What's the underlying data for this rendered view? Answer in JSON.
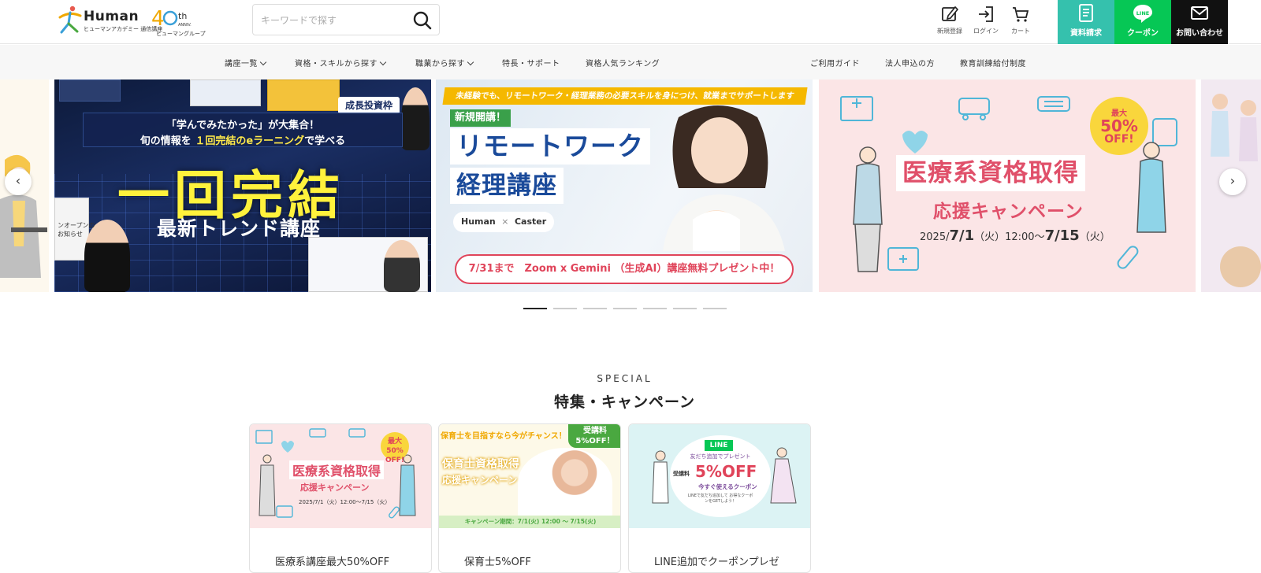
{
  "header": {
    "brand": "Human",
    "brand_sub": "ヒューマンアカデミー 通信講座",
    "anniv": "40th",
    "anniv_sub": "ヒューマングループ",
    "search": {
      "placeholder": "キーワードで探す",
      "value": ""
    },
    "icons": [
      {
        "label": "新規登録",
        "icon": "edit-icon"
      },
      {
        "label": "ログイン",
        "icon": "login-icon"
      },
      {
        "label": "カート",
        "icon": "cart-icon"
      }
    ],
    "cta": {
      "docs": "資料請求",
      "coupon": "クーポン",
      "coupon_icon_text": "LINE",
      "contact": "お問い合わせ"
    },
    "colors": {
      "docs": "#35c1ad",
      "coupon": "#06c755",
      "contact": "#111111"
    }
  },
  "nav": {
    "left": [
      "講座一覧",
      "資格・スキルから探す",
      "職業から探す",
      "特長・サポート",
      "資格人気ランキング"
    ],
    "right": [
      "ご利用ガイド",
      "法人申込の方",
      "教育訓練給付制度"
    ]
  },
  "carousel": {
    "slide1": {
      "banner_l1": "「学んでみたかった」が大集合！",
      "banner_l2_a": "旬の情報を",
      "banner_l2_hl": "１回完結のeラーニング",
      "banner_l2_b": "で学べる",
      "main": "一回完結",
      "sub": "最新トレンド講座",
      "tag": "成長投資枠",
      "side_note": "ンオープンの\nお知らせ"
    },
    "slide2": {
      "top": "未経験でも、リモートワーク・経理業務の必要スキルを身につけ、就業までサポートします",
      "new": "新規開講！",
      "title1": "リモートワーク",
      "title2": "経理講座",
      "collab_a": "Human",
      "collab_x": "×",
      "collab_b": "Caster",
      "pill": "7/31まで　Zoom x Gemini （生成AI）講座無料プレゼント中！"
    },
    "slide3": {
      "title": "医療系資格取得",
      "sub": "応援キャンペーン",
      "date_a": "2025/",
      "date_b": "7/1",
      "date_c": "（火）12:00～",
      "date_d": "7/15",
      "date_e": "（火）",
      "badge_1": "最大",
      "badge_2": "50%",
      "badge_3": "OFF!"
    },
    "dots": 7,
    "active_dot": 0
  },
  "special": {
    "kicker": "SPECIAL",
    "title": "特集・キャンペーン",
    "cards": [
      {
        "caption": "医療系講座最大50%OFF",
        "title": "医療系資格取得",
        "sub": "応援キャンペーン",
        "date": "2025/7/1（火）12:00～7/15（火）",
        "badge": "最大\n50%\nOFF!"
      },
      {
        "caption": "保育士5%OFF",
        "top": "保育士を目指すなら今がチャンス！",
        "badge_1": "受講料",
        "badge_2": "5%OFF！",
        "title1": "保育士資格取得",
        "title2": "応援キャンペーン",
        "bar": "キャンペーン期間：7/1(火) 12:00 ～ 7/15(火)"
      },
      {
        "caption": "LINE追加でクーポンプレゼ",
        "line": "LINE",
        "add": "友だち追加でプレゼント",
        "label": "受講料",
        "off": "5%OFF",
        "now": "今すぐ使えるクーポン",
        "note": "LINEで友だち追加して お得なクーポンをGETしよう！"
      }
    ]
  }
}
